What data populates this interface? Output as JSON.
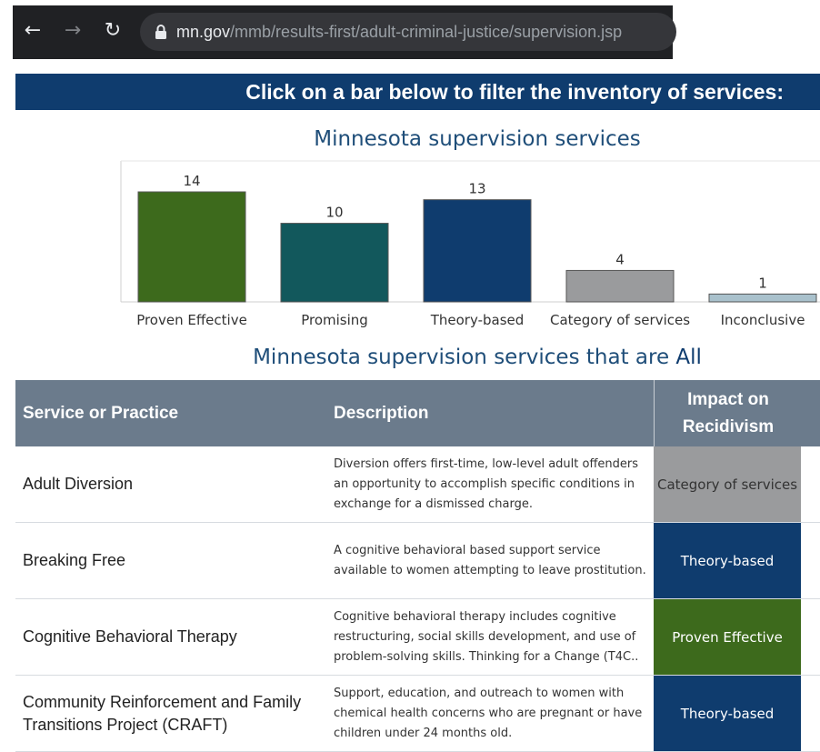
{
  "browser": {
    "url_host": "mn.gov",
    "url_path": "/mmb/results-first/adult-criminal-justice/supervision.jsp",
    "back_icon": "arrow-left-icon",
    "forward_icon": "arrow-right-icon",
    "reload_icon": "reload-icon",
    "lock_icon": "lock-icon"
  },
  "banner": {
    "text": "Click on a bar below to filter the inventory of services:",
    "color": "#0f3c6e"
  },
  "chart": {
    "title": "Minnesota supervision services"
  },
  "chart_data": {
    "type": "bar",
    "title": "Minnesota supervision services",
    "categories": [
      "Proven Effective",
      "Promising",
      "Theory-based",
      "Category of services",
      "Inconclusive"
    ],
    "values": [
      14,
      10,
      13,
      4,
      1
    ],
    "colors": [
      "#3d6a1c",
      "#12585c",
      "#0f3c6e",
      "#9a9b9d",
      "#a9c1cc"
    ],
    "data_labels": [
      "14",
      "10",
      "13",
      "4",
      "1"
    ],
    "ylim": [
      0,
      14
    ],
    "grid": false,
    "legend": "none"
  },
  "table": {
    "title_prefix": "Minnesota supervision services that are",
    "title_selection": "All",
    "headers": {
      "service": "Service or Practice",
      "description": "Description",
      "impact": "Impact on Recidivism"
    },
    "rows": [
      {
        "service": "Adult Diversion",
        "description": "Diversion offers first-time, low-level adult offenders an opportunity to accomplish specific conditions in exchange for a dismissed charge.",
        "impact": "Category of services",
        "impact_bg": "#9a9b9d",
        "impact_fg": "#333333"
      },
      {
        "service": "Breaking Free",
        "description": "A cognitive behavioral based support service available to women attempting to leave prostitution.",
        "impact": "Theory-based",
        "impact_bg": "#0f3c6e",
        "impact_fg": "#ffffff"
      },
      {
        "service": "Cognitive Behavioral Therapy",
        "description": "Cognitive behavioral therapy includes cognitive restructuring, social skills development, and use of problem-solving skills. Thinking for a Change (T4C..",
        "impact": "Proven Effective",
        "impact_bg": "#3d6a1c",
        "impact_fg": "#ffffff"
      },
      {
        "service": "Community Reinforcement and Family Transitions Project (CRAFT)",
        "description": "Support, education, and outreach to women with chemical health concerns who are pregnant or have children under 24 months old.",
        "impact": "Theory-based",
        "impact_bg": "#0f3c6e",
        "impact_fg": "#ffffff"
      }
    ]
  }
}
